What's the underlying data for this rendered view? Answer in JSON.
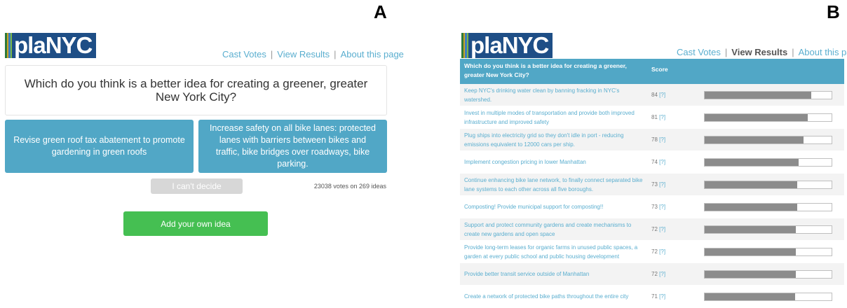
{
  "labels": {
    "a": "A",
    "b": "B"
  },
  "logo": {
    "part1": "pla",
    "part2": "N",
    "part3": "YC",
    "stripe_colors": [
      "#2d7a3a",
      "#c9a227",
      "#3a7dbf",
      "#7ab648"
    ],
    "bg": "#1e4e86"
  },
  "nav_a": {
    "cast": "Cast Votes",
    "results": "View Results",
    "about": "About this page",
    "sep": "|"
  },
  "nav_b": {
    "cast": "Cast Votes",
    "results": "View Results",
    "about": "About this page",
    "sep": "|"
  },
  "vote_panel": {
    "question": "Which do you think is a better idea for creating a greener, greater New York City?",
    "idea_left": "Revise green roof tax abatement to promote gardening in green roofs",
    "idea_right": "Increase safety on all bike lanes: protected lanes with barriers between bikes and traffic, bike bridges over roadways, bike parking.",
    "cant_decide": "I can't decide",
    "vote_count": "23038 votes on 269 ideas",
    "add_idea": "Add your own idea"
  },
  "results_panel": {
    "header_idea": "Which do you think is a better idea for creating a greener, greater New York City?",
    "header_score": "Score",
    "help_marker": "[?]",
    "rows": [
      {
        "idea": "Keep NYC's drinking water clean by banning fracking in NYC's watershed.",
        "score": 84
      },
      {
        "idea": "Invest in multiple modes of transportation and provide both improved infrastructure and improved safety",
        "score": 81
      },
      {
        "idea": "Plug ships into electricity grid so they don't idle in port - reducing emissions equivalent to 12000 cars per ship.",
        "score": 78
      },
      {
        "idea": "Implement congestion pricing in lower Manhattan",
        "score": 74
      },
      {
        "idea": "Continue enhancing bike lane network, to finally connect separated bike lane systems to each other across all five boroughs.",
        "score": 73
      },
      {
        "idea": "Composting! Provide municipal support for composting!!",
        "score": 73
      },
      {
        "idea": "Support and protect community gardens and create mechanisms to create new gardens and open space",
        "score": 72
      },
      {
        "idea": "Provide long-term leases for organic farms in unused public spaces, a garden at every public school and public housing development",
        "score": 72
      },
      {
        "idea": "Provide better transit service outside of Manhattan",
        "score": 72
      },
      {
        "idea": "Create a network of protected bike paths throughout the entire city",
        "score": 71
      }
    ]
  }
}
